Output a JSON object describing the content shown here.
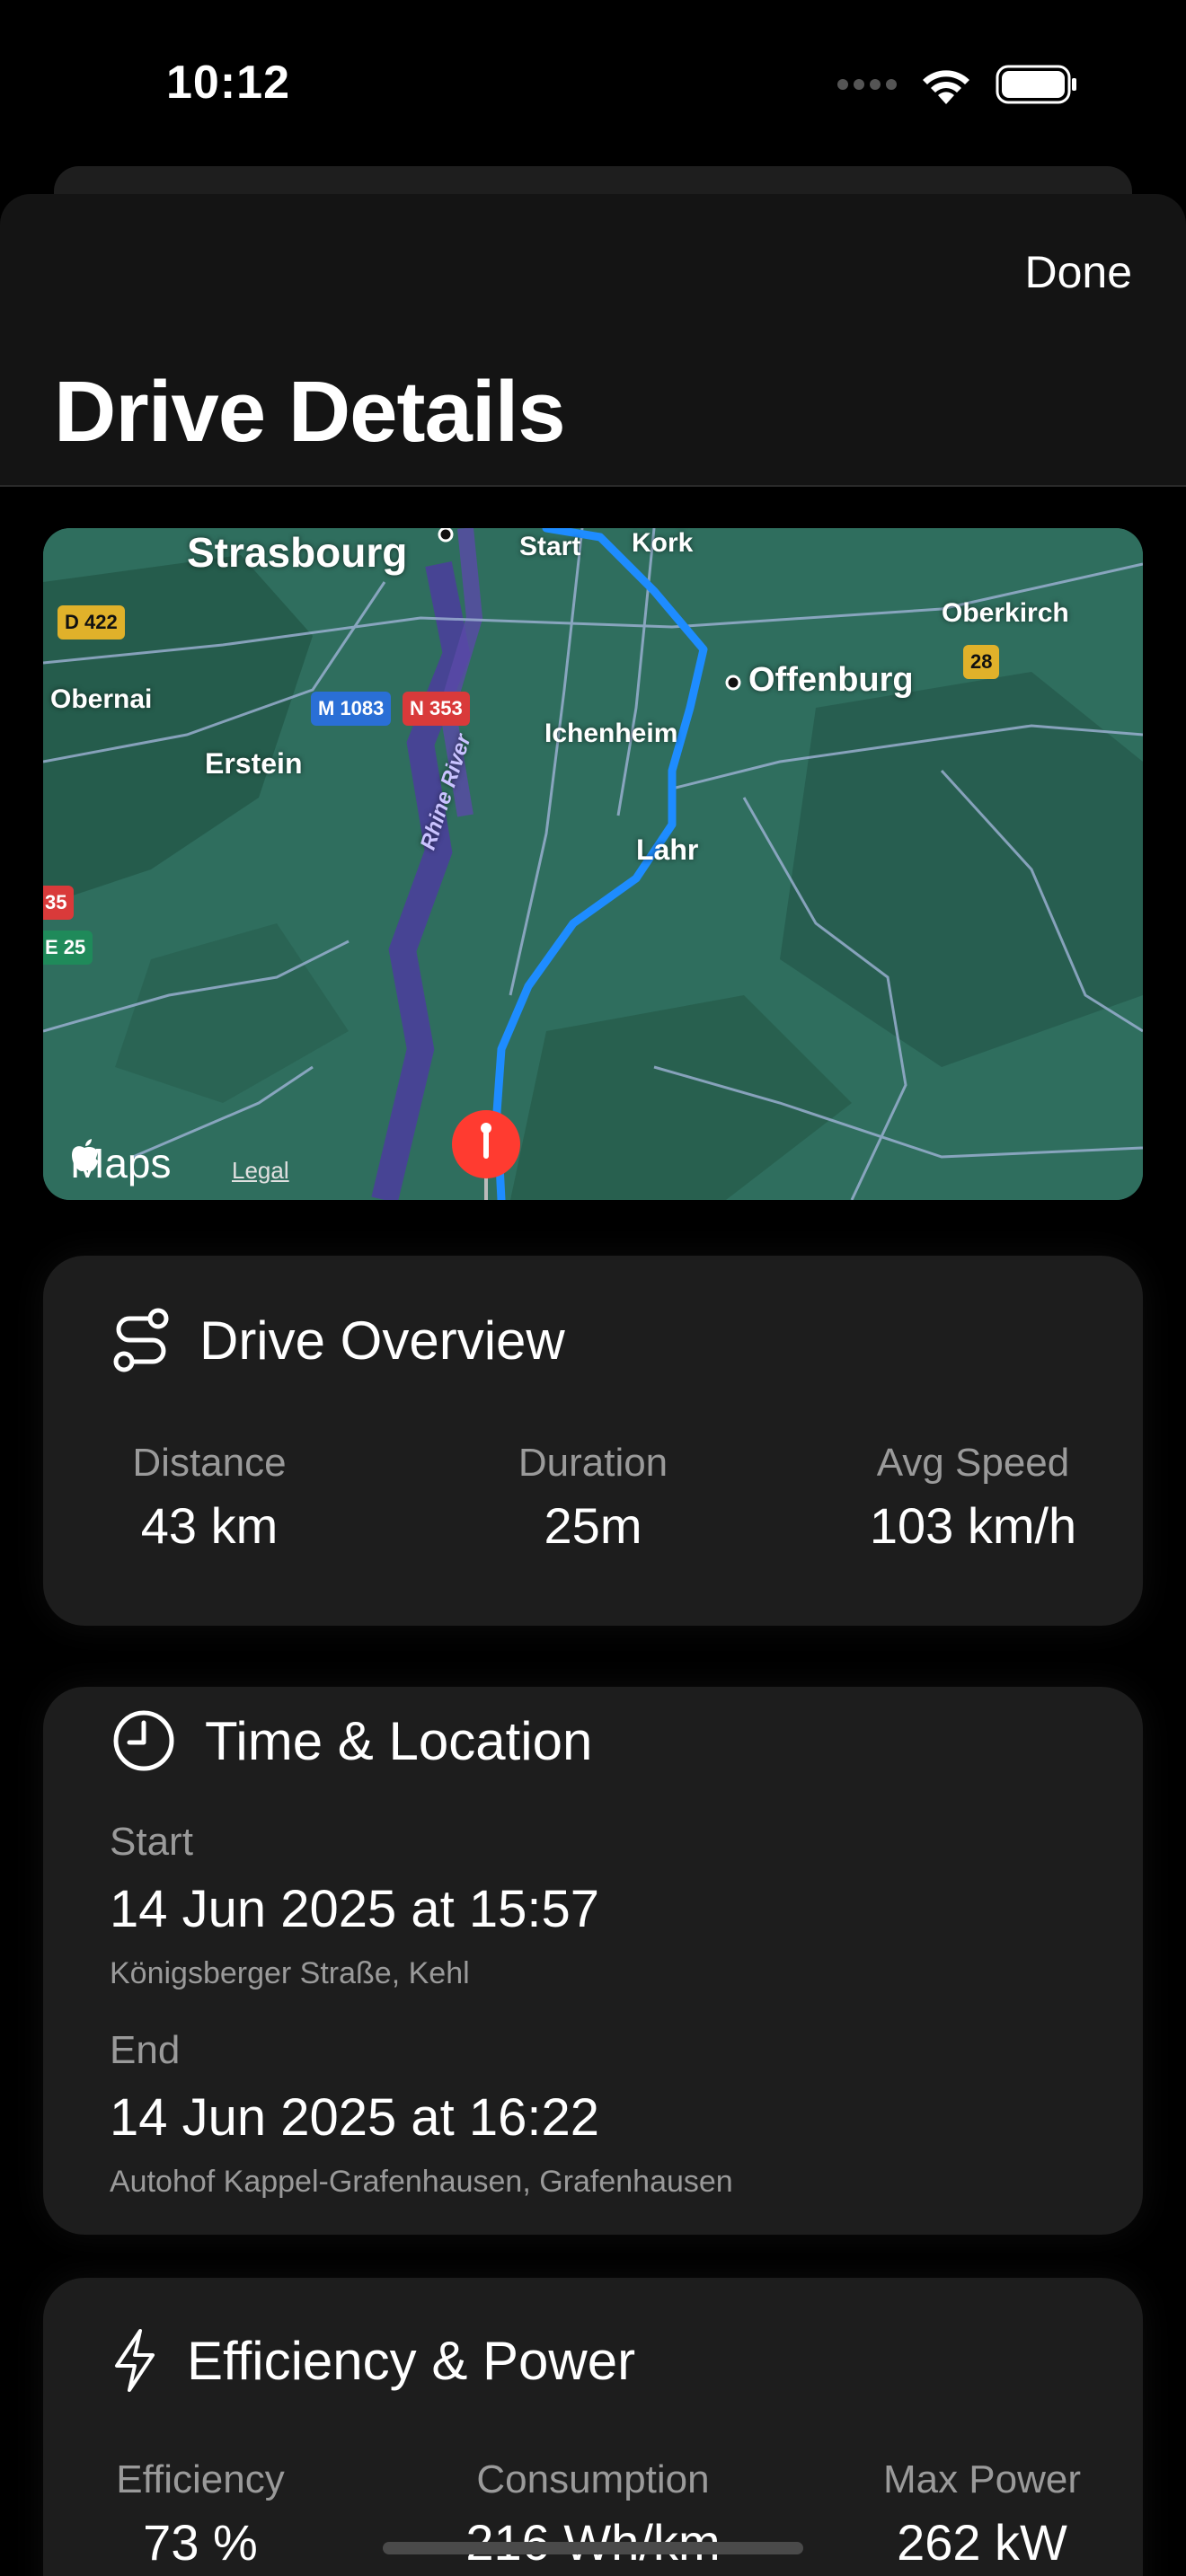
{
  "status": {
    "time": "10:12"
  },
  "nav": {
    "done_label": "Done",
    "title": "Drive Details"
  },
  "map": {
    "labels": {
      "strasbourg": "Strasbourg",
      "start": "Start",
      "kork": "Kork",
      "oberkirch": "Oberkirch",
      "offenburg": "Offenburg",
      "obernai": "Obernai",
      "ichenheim": "Ichenheim",
      "erstein": "Erstein",
      "lahr": "Lahr",
      "rhine": "Rhine River"
    },
    "badges": {
      "d422": "D 422",
      "m1083": "M 1083",
      "n353": "N 353",
      "r28": "28",
      "e25": "E 25",
      "r35": "35"
    },
    "logo": "Maps",
    "legal": "Legal"
  },
  "overview": {
    "title": "Drive Overview",
    "stats": [
      {
        "label": "Distance",
        "value": "43 km"
      },
      {
        "label": "Duration",
        "value": "25m"
      },
      {
        "label": "Avg Speed",
        "value": "103 km/h"
      }
    ]
  },
  "time_location": {
    "title": "Time & Location",
    "start_label": "Start",
    "start_time": "14 Jun 2025 at 15:57",
    "start_place": "Königsberger Straße, Kehl",
    "end_label": "End",
    "end_time": "14 Jun 2025 at 16:22",
    "end_place": "Autohof Kappel-Grafenhausen, Grafenhausen"
  },
  "efficiency": {
    "title": "Efficiency & Power",
    "stats": [
      {
        "label": "Efficiency",
        "value": "73 %"
      },
      {
        "label": "Consumption",
        "value": "216 Wh/km"
      },
      {
        "label": "Max Power",
        "value": "262 kW"
      }
    ]
  },
  "colors": {
    "route": "#1e8cff",
    "pin": "#ff3b30",
    "card": "#1d1d1d"
  }
}
